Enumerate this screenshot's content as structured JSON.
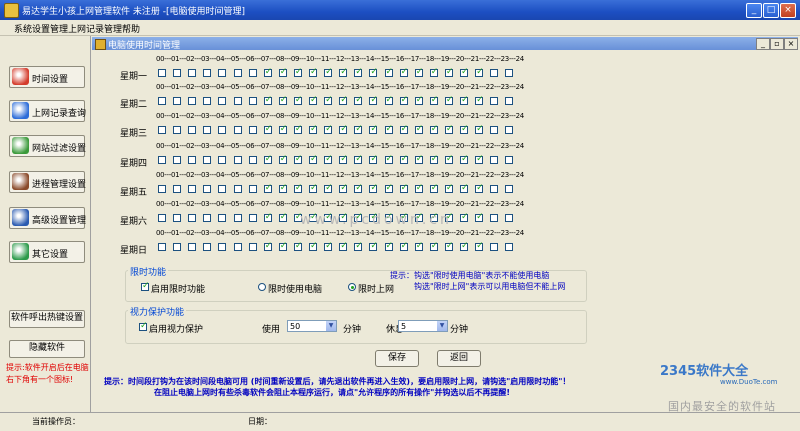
{
  "window": {
    "title": "易达学生小孩上网管理软件 未注册 -[电脑使用时间管理]",
    "min": "_",
    "max": "□",
    "close": "×"
  },
  "menu": [
    "系统设置管理",
    "上网记录管理",
    "帮助"
  ],
  "child": {
    "title": "电脑使用时间管理",
    "min": "_",
    "restore": "▫",
    "close": "×"
  },
  "sidebar": [
    {
      "label": "时间设置",
      "icon": "clock-icon",
      "color": "#d43c2c"
    },
    {
      "label": "上网记录查询",
      "icon": "ie-globe-icon",
      "color": "#2c6cd8"
    },
    {
      "label": "网站过滤设置",
      "icon": "globe-filter-icon",
      "color": "#3a9a3a"
    },
    {
      "label": "进程管理设置",
      "icon": "tools-icon",
      "color": "#8a4a2a"
    },
    {
      "label": "高级设置管理",
      "icon": "network-icon",
      "color": "#2a5ab0"
    },
    {
      "label": "其它设置",
      "icon": "gear-icon",
      "color": "#2c9a4a"
    }
  ],
  "sidebar_bottom": {
    "hotkey": "软件呼出热键设置",
    "hide": "隐藏软件"
  },
  "hint_red": "提示:软件开启后在电脑右下角有一个图标!",
  "hour_header": "00---01---02---03---04---05---06---07---08---09---10---11---12---13---14---15---16---17---18---19---20---21---22---23---24",
  "days": [
    {
      "label": "星期一",
      "checked": [
        false,
        false,
        false,
        false,
        false,
        false,
        false,
        true,
        true,
        true,
        true,
        true,
        true,
        true,
        true,
        true,
        true,
        true,
        true,
        true,
        true,
        true,
        false,
        false
      ]
    },
    {
      "label": "星期二",
      "checked": [
        false,
        false,
        false,
        false,
        false,
        false,
        false,
        true,
        true,
        true,
        true,
        true,
        true,
        true,
        true,
        true,
        true,
        true,
        true,
        true,
        true,
        true,
        false,
        false
      ]
    },
    {
      "label": "星期三",
      "checked": [
        false,
        false,
        false,
        false,
        false,
        false,
        false,
        true,
        true,
        true,
        true,
        true,
        true,
        true,
        true,
        true,
        true,
        true,
        true,
        true,
        true,
        true,
        false,
        false
      ]
    },
    {
      "label": "星期四",
      "checked": [
        false,
        false,
        false,
        false,
        false,
        false,
        false,
        true,
        true,
        true,
        true,
        true,
        true,
        true,
        true,
        true,
        true,
        true,
        true,
        true,
        true,
        true,
        false,
        false
      ]
    },
    {
      "label": "星期五",
      "checked": [
        false,
        false,
        false,
        false,
        false,
        false,
        false,
        true,
        true,
        true,
        true,
        true,
        true,
        true,
        true,
        true,
        true,
        true,
        true,
        true,
        true,
        true,
        false,
        false
      ]
    },
    {
      "label": "星期六",
      "checked": [
        false,
        false,
        false,
        false,
        false,
        false,
        false,
        true,
        true,
        true,
        true,
        true,
        true,
        true,
        true,
        true,
        true,
        true,
        true,
        true,
        true,
        true,
        false,
        false
      ]
    },
    {
      "label": "星期日",
      "checked": [
        false,
        false,
        false,
        false,
        false,
        false,
        false,
        true,
        true,
        true,
        true,
        true,
        true,
        true,
        true,
        true,
        true,
        true,
        true,
        true,
        true,
        true,
        false,
        false
      ]
    }
  ],
  "time_limit": {
    "title": "限时功能",
    "enable_label": "启用限时功能",
    "enable_checked": true,
    "radio_pc": "限时使用电脑",
    "radio_net": "限时上网",
    "selected": "限时上网",
    "tip1": "提示：钩选\"限时使用电脑\"表示不能使用电脑",
    "tip2": "钩选\"限时上网\"表示可以用电脑但不能上网"
  },
  "eye": {
    "title": "视力保护功能",
    "enable_label": "启用视力保护",
    "enable_checked": true,
    "use_label": "使用",
    "use_value": "50",
    "rest_label": "休息",
    "rest_value": "5",
    "unit": "分钟"
  },
  "buttons": {
    "save": "保存",
    "back": "返回"
  },
  "bottom_tip1": "提示：时间段打钩为在该时间段电脑可用 (时间重新设置后，请先退出软件再进入生效)，要启用限时上网，请钩选\"启用限时功能\"！",
  "bottom_tip2": "在阻止电脑上网时有些杀毒软件会阻止本程序运行，请点\"允许程序的所有操作\"并钩选以后不再提醒!",
  "status": {
    "operator": "当前操作员：",
    "date": "日期："
  },
  "watermark": {
    "center": "www.pcdown.cn",
    "brand": "2345软件大全",
    "url": "www.DuoTe.com",
    "slogan": "国内最安全的软件站"
  },
  "colors": {
    "accent": "#0046d5",
    "check": "#21a121",
    "warn": "#e00000"
  }
}
